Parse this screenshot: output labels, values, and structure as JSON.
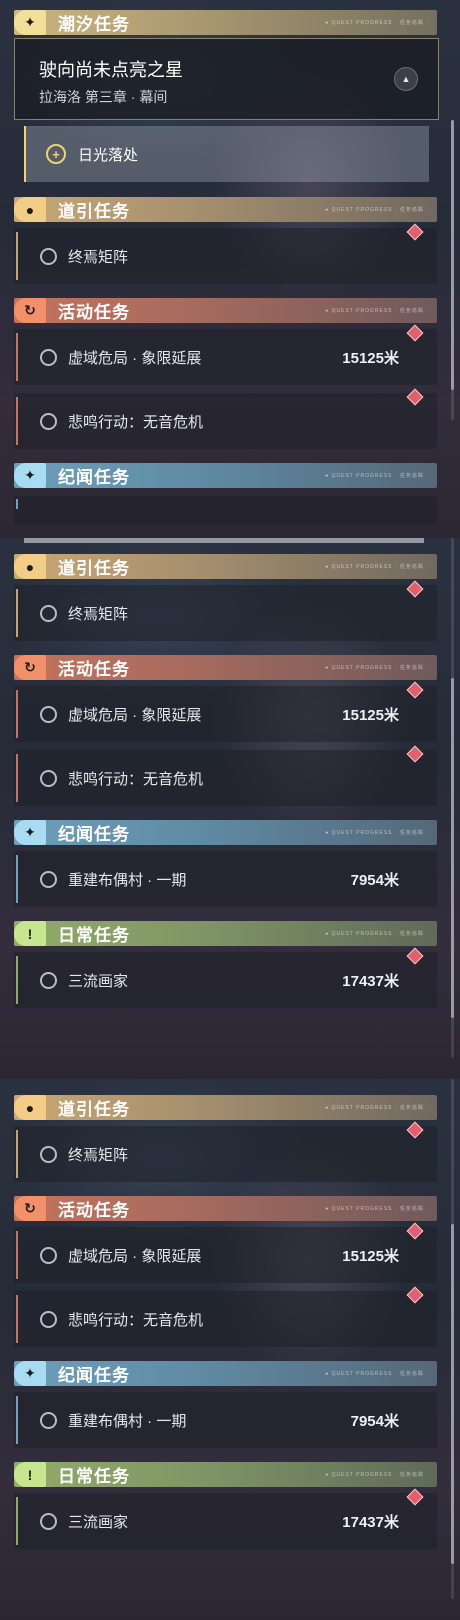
{
  "categories": {
    "tide": "潮汐任务",
    "guide": "道引任务",
    "event": "活动任务",
    "lore": "纪闻任务",
    "daily": "日常任务",
    "tag_text": "● QUEST PROGRESS · 任务追踪 ·"
  },
  "main_quest": {
    "title": "驶向尚未点亮之星",
    "subtitle": "拉海洛 第三章 · 幕间",
    "current_step": "日光落处"
  },
  "quests": {
    "guide_1": {
      "name": "终焉矩阵"
    },
    "event_1": {
      "name": "虚域危局 · 象限延展",
      "distance": "15125米"
    },
    "event_2": {
      "name": "悲鸣行动：无音危机"
    },
    "lore_1": {
      "name": "重建布偶村 · 一期",
      "distance": "7954米"
    },
    "daily_1": {
      "name": "三流画家",
      "distance": "17437米"
    }
  },
  "icons": {
    "tide": "sparkle-icon",
    "guide": "map-pin-icon",
    "event": "refresh-arrow-icon",
    "lore": "sparkle-icon",
    "daily": "exclamation-box-icon",
    "pending": "hollow-circle-icon",
    "track_marker": "diamond-marker-icon",
    "collapse": "chevron-up-icon"
  },
  "colors": {
    "tide": "#f1df9a",
    "guide": "#f3cc86",
    "event": "#f2906a",
    "lore": "#a7dcf2",
    "daily": "#c6e690",
    "marker": "#e35f6e",
    "highlight": "#f0d36c"
  }
}
